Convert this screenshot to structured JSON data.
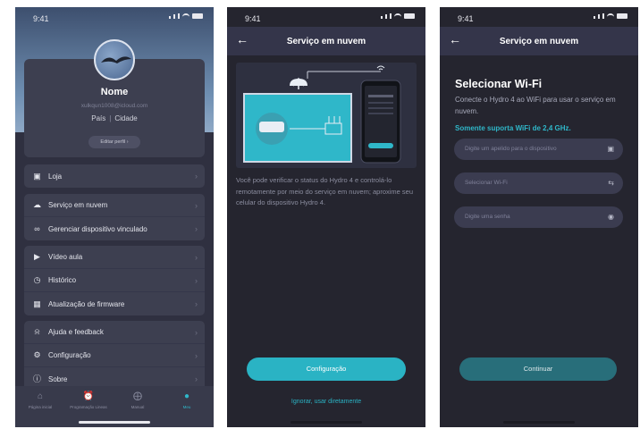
{
  "status": {
    "time": "9:41"
  },
  "profile": {
    "name": "Nome",
    "email": "xulkqun1008@icloud.com",
    "country": "País",
    "separator": "|",
    "city": "Cidade",
    "edit_label": "Editar perfil ›"
  },
  "menu": {
    "group1": [
      {
        "label": "Loja",
        "icon": "bag-icon"
      }
    ],
    "group2": [
      {
        "label": "Serviço em nuvem",
        "icon": "cloud-icon"
      },
      {
        "label": "Gerenciar dispositivo vinculado",
        "icon": "link-icon"
      }
    ],
    "group3": [
      {
        "label": "Vídeo aula",
        "icon": "video-icon"
      },
      {
        "label": "Histórico",
        "icon": "history-icon"
      },
      {
        "label": "Atualização de firmware",
        "icon": "chip-icon"
      }
    ],
    "group4": [
      {
        "label": "Ajuda e feedback",
        "icon": "headset-icon"
      },
      {
        "label": "Configuração",
        "icon": "gear-icon"
      },
      {
        "label": "Sobre",
        "icon": "info-icon"
      }
    ]
  },
  "tabs": [
    {
      "label": "Página inicial",
      "icon": "home-icon"
    },
    {
      "label": "Programação Lineas",
      "icon": "alarm-icon"
    },
    {
      "label": "Manual",
      "icon": "compass-icon"
    },
    {
      "label": "Meu",
      "icon": "person-icon",
      "active": true
    }
  ],
  "cloud": {
    "title": "Serviço em nuvem",
    "description": "Você pode verificar o status do Hydro 4 e controlá-lo remotamente por meio do serviço em nuvem; aproxime seu celular do dispositivo Hydro 4.",
    "config_button": "Configuração",
    "skip_link": "Ignorar, usar diretamente"
  },
  "wifi": {
    "title": "Serviço em nuvem",
    "heading": "Selecionar Wi-Fi",
    "subtitle": "Conecte o Hydro 4 ao WiFi para usar o serviço em nuvem.",
    "note": "Somente suporta WiFi de 2,4 GHz.",
    "nickname_placeholder": "Digite um apelido para o dispositivo",
    "select_wifi_placeholder": "Selecionar Wi-Fi",
    "password_placeholder": "Digite uma senha",
    "continue_button": "Continuar"
  },
  "colors": {
    "accent": "#2ab3c4",
    "background": "#25252f",
    "card": "#3d3f50"
  }
}
